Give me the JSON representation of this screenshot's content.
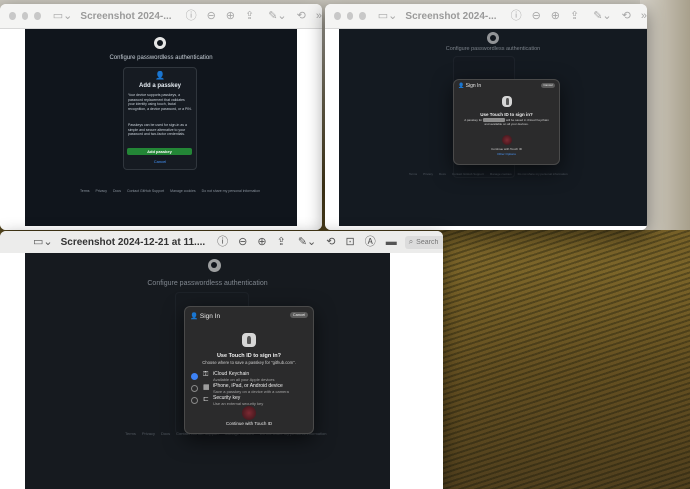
{
  "windows": [
    {
      "title": "Screenshot 2024-..."
    },
    {
      "title": "Screenshot 2024-..."
    },
    {
      "title": "Screenshot 2024-12-21 at 11...."
    }
  ],
  "search": {
    "placeholder": "Search"
  },
  "github": {
    "heading": "Configure passwordless authentication",
    "card_title": "Add a passkey",
    "card_text_1": "Your device supports passkeys, a password replacement that validates your identity using touch, facial recognition, a device password, or a PIN.",
    "card_text_2": "Passkeys can be used for sign-in as a simple and secure alternative to your password and two-factor credentials.",
    "add_button": "Add passkey",
    "cancel_link": "Cancel",
    "footer": [
      "Terms",
      "Privacy",
      "Docs",
      "Contact GitHub Support",
      "Manage cookies",
      "Do not share my personal information"
    ]
  },
  "signin_small": {
    "title": "Sign In",
    "cancel": "Cancel",
    "heading": "Use Touch ID to sign in?",
    "text_start": "A passkey for",
    "text_end": "will be saved in iCloud Keychain and available on all your devices.",
    "continue": "Continue with Touch ID",
    "other": "Other Options"
  },
  "signin_large": {
    "title": "Sign In",
    "cancel": "Cancel",
    "heading": "Use Touch ID to sign in?",
    "subheading": "Choose where to save a passkey for \"github.com\".",
    "options": [
      {
        "label": "iCloud Keychain",
        "sub": "Available on all your Apple devices",
        "icon": "key-icon",
        "selected": true
      },
      {
        "label": "iPhone, iPad, or Android device",
        "sub": "Save a passkey on a device with a camera",
        "icon": "qr-code-icon",
        "selected": false
      },
      {
        "label": "Security key",
        "sub": "Use an external security key",
        "icon": "security-key-icon",
        "selected": false
      }
    ],
    "continue": "Continue with Touch ID"
  }
}
